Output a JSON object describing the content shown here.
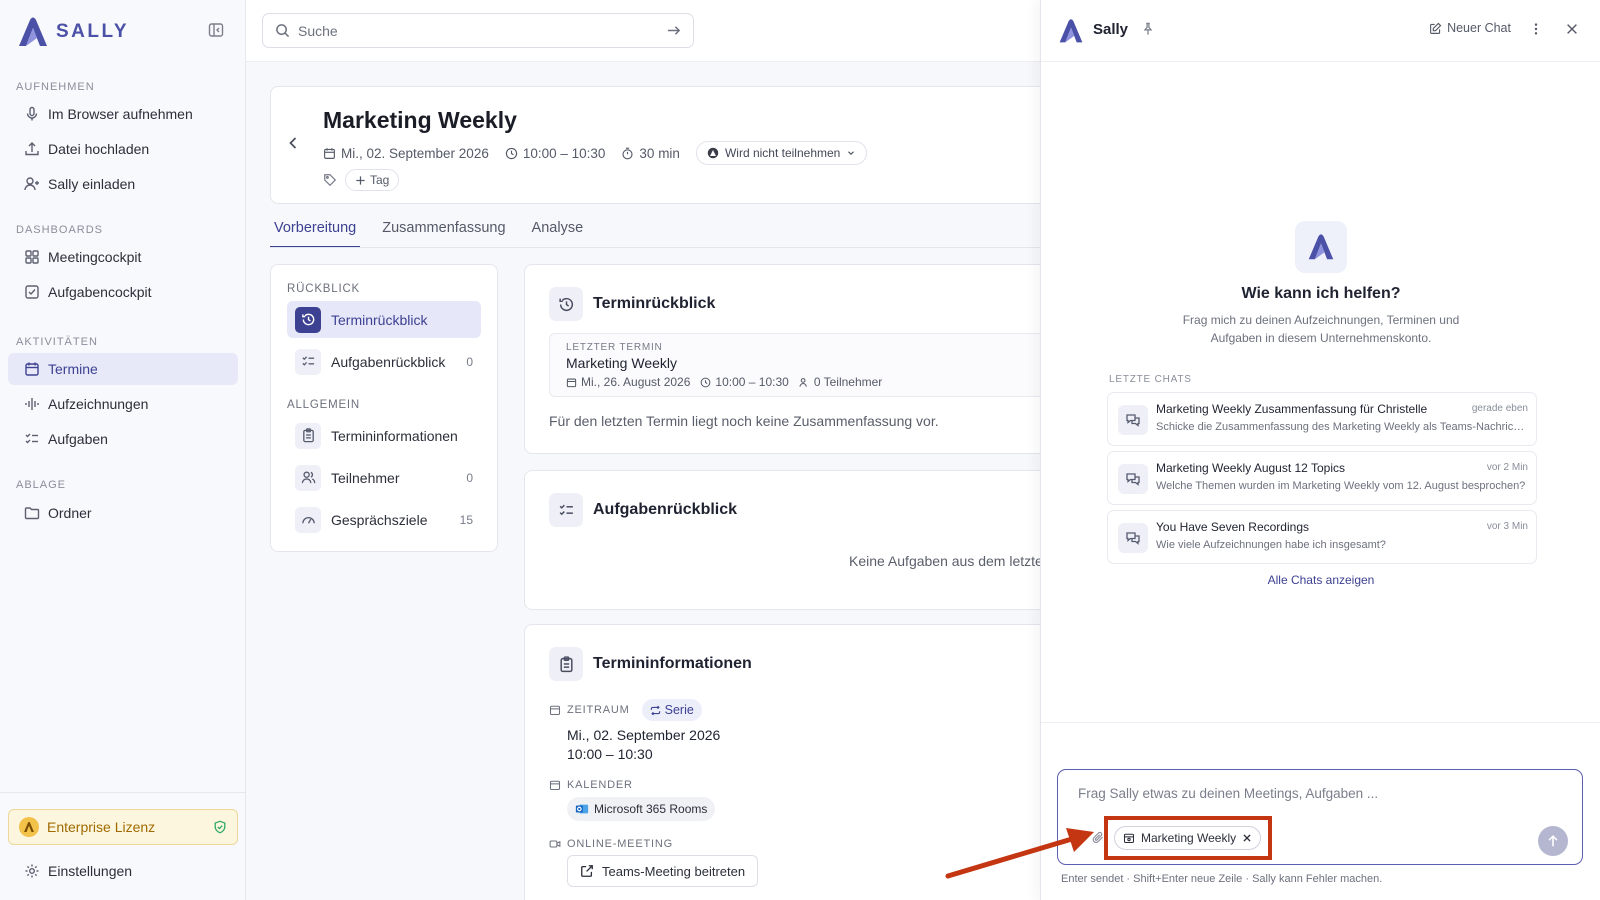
{
  "sidebar": {
    "logo_text": "SALLY",
    "sections": {
      "record": "AUFNEHMEN",
      "dashboards": "DASHBOARDS",
      "activities": "AKTIVITÄTEN",
      "storage": "ABLAGE"
    },
    "items": {
      "record_browser": "Im Browser aufnehmen",
      "upload_file": "Datei hochladen",
      "invite_sally": "Sally einladen",
      "meetingcockpit": "Meetingcockpit",
      "taskcockpit": "Aufgabencockpit",
      "appointments": "Termine",
      "recordings": "Aufzeichnungen",
      "tasks": "Aufgaben",
      "folders": "Ordner"
    },
    "license": "Enterprise Lizenz",
    "settings": "Einstellungen",
    "active_item": "Termine"
  },
  "search": {
    "placeholder": "Suche"
  },
  "meeting": {
    "title": "Marketing Weekly",
    "date": "Mi., 02. September 2026",
    "time": "10:00 – 10:30",
    "duration": "30 min",
    "attendance": "Wird nicht teilnehmen",
    "tag_button": "Tag"
  },
  "tabs": [
    "Vorbereitung",
    "Zusammenfassung",
    "Analyse"
  ],
  "active_tab": "Vorbereitung",
  "left_nav": {
    "review_label": "RÜCKBLICK",
    "general_label": "ALLGEMEIN",
    "items": [
      {
        "label": "Terminrückblick",
        "count": ""
      },
      {
        "label": "Aufgabenrückblick",
        "count": "0"
      },
      {
        "label": "Termininformationen",
        "count": ""
      },
      {
        "label": "Teilnehmer",
        "count": "0"
      },
      {
        "label": "Gesprächsziele",
        "count": "15"
      }
    ]
  },
  "review_card": {
    "title": "Terminrückblick",
    "last_label": "LETZTER TERMIN",
    "last_title": "Marketing Weekly",
    "last_date": "Mi., 26. August 2026",
    "last_time": "10:00 – 10:30",
    "last_participants": "0 Teilnehmer",
    "empty_text": "Für den letzten Termin liegt noch keine Zusammenfassung vor."
  },
  "task_card": {
    "title": "Aufgabenrückblick",
    "empty_text": "Keine Aufgaben aus dem letzte"
  },
  "info_card": {
    "title": "Termininformationen",
    "period_label": "ZEITRAUM",
    "series": "Serie",
    "date": "Mi., 02. September 2026",
    "time": "10:00 – 10:30",
    "calendar_label": "KALENDER",
    "calendar": "Microsoft 365 Rooms",
    "online_label": "ONLINE-MEETING",
    "teams_button": "Teams-Meeting beitreten"
  },
  "chat": {
    "name": "Sally",
    "new_chat": "Neuer Chat",
    "hero_title": "Wie kann ich helfen?",
    "hero_sub": "Frag mich zu deinen Aufzeichnungen, Terminen und Aufgaben in diesem Unternehmenskonto.",
    "recent_label": "LETZTE CHATS",
    "recent": [
      {
        "title": "Marketing Weekly Zusammenfassung für Christelle",
        "time": "gerade eben",
        "sub": "Schicke die Zusammenfassung des Marketing Weekly als Teams-Nachricht an Christelle"
      },
      {
        "title": "Marketing Weekly August 12 Topics",
        "time": "vor 2 Min",
        "sub": "Welche Themen wurden im Marketing Weekly vom 12. August besprochen?"
      },
      {
        "title": "You Have Seven Recordings",
        "time": "vor 3 Min",
        "sub": "Wie viele Aufzeichnungen habe ich insgesamt?"
      }
    ],
    "all_chats": "Alle Chats anzeigen",
    "input_placeholder": "Frag Sally etwas zu deinen Meetings, Aufgaben ...",
    "context_chip": "Marketing Weekly",
    "hint": "Enter sendet · Shift+Enter neue Zeile · Sally kann Fehler machen."
  },
  "colors": {
    "brand": "#3d4192",
    "highlight": "#c43512",
    "license": "#a06a00"
  }
}
